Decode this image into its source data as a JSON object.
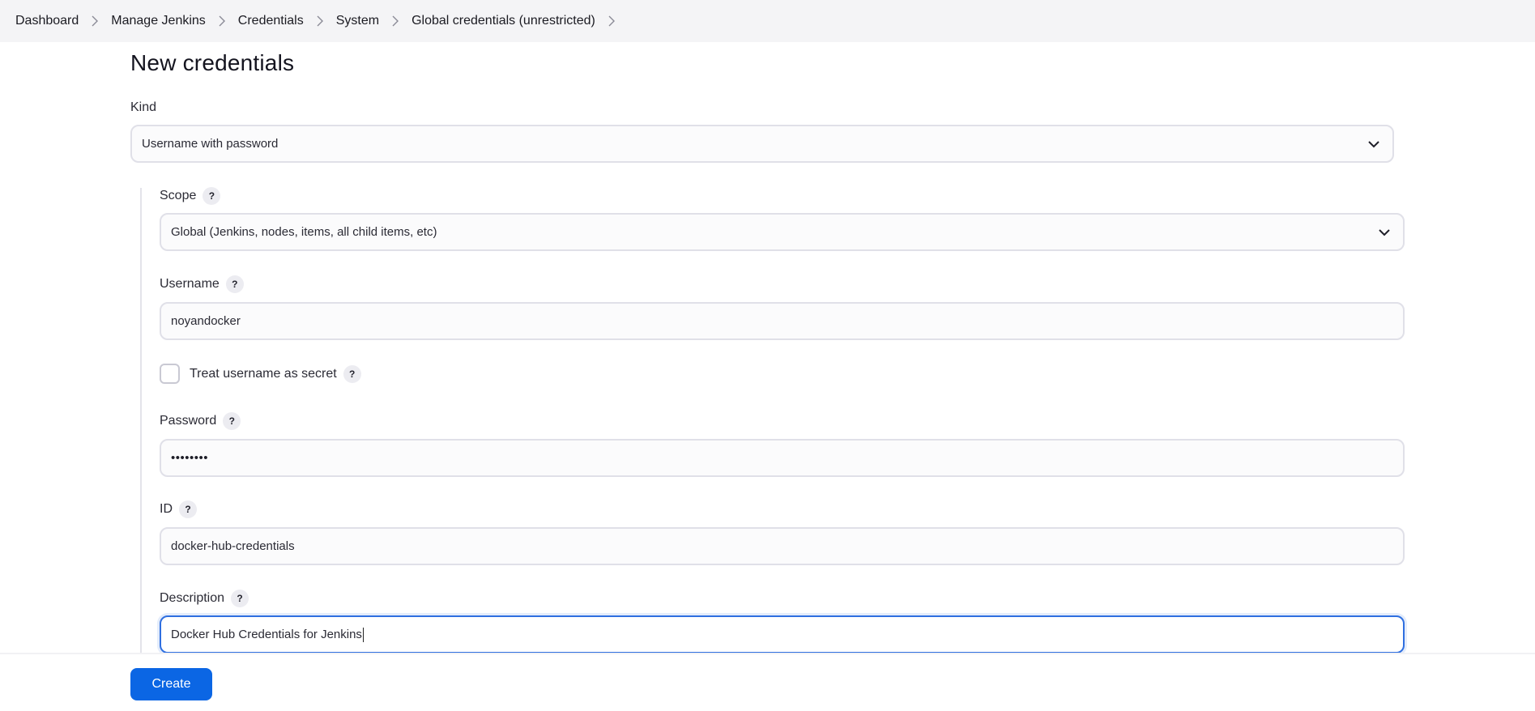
{
  "breadcrumb": {
    "items": [
      {
        "label": "Dashboard"
      },
      {
        "label": "Manage Jenkins"
      },
      {
        "label": "Credentials"
      },
      {
        "label": "System"
      },
      {
        "label": "Global credentials (unrestricted)"
      }
    ]
  },
  "page": {
    "title": "New credentials"
  },
  "form": {
    "kind": {
      "label": "Kind",
      "value": "Username with password"
    },
    "scope": {
      "label": "Scope",
      "help": "?",
      "value": "Global (Jenkins, nodes, items, all child items, etc)"
    },
    "username": {
      "label": "Username",
      "help": "?",
      "value": "noyandocker"
    },
    "treat_secret": {
      "label": "Treat username as secret",
      "help": "?",
      "checked": false
    },
    "password": {
      "label": "Password",
      "help": "?",
      "value": "••••••••"
    },
    "id": {
      "label": "ID",
      "help": "?",
      "value": "docker-hub-credentials"
    },
    "description": {
      "label": "Description",
      "help": "?",
      "value": "Docker Hub Credentials for Jenkins"
    }
  },
  "actions": {
    "create_label": "Create"
  },
  "colors": {
    "primary": "#0b66e4",
    "breadcrumb_bg": "#f4f4f6",
    "focus": "#2f6fe0"
  }
}
